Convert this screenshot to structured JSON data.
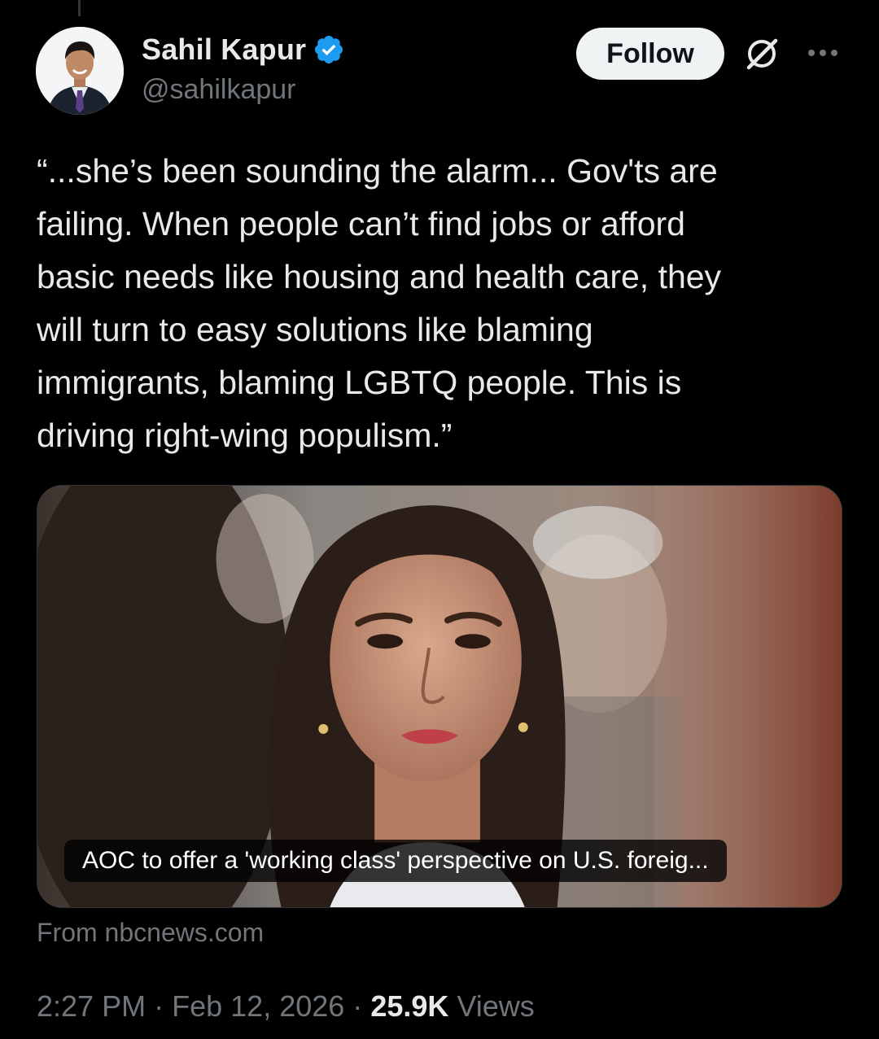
{
  "author": {
    "display_name": "Sahil Kapur",
    "handle": "@sahilkapur",
    "verified": true
  },
  "actions": {
    "follow_label": "Follow",
    "grok_icon": "grok-icon",
    "more_icon": "more-options-icon"
  },
  "tweet": {
    "text": "“...she’s been sounding the alarm... Gov'ts are\nfailing. When people can’t find jobs or afford\nbasic needs like housing and health care, they\nwill turn to easy solutions like blaming\nimmigrants, blaming LGBTQ people. This is\ndriving right-wing populism.”"
  },
  "card": {
    "title": "AOC to offer a 'working class' perspective on U.S. foreig...",
    "source": "From nbcnews.com"
  },
  "meta": {
    "time": "2:27 PM",
    "separator": "·",
    "date": "Feb 12, 2026",
    "views_count": "25.9K",
    "views_label": "Views"
  },
  "colors": {
    "background": "#000000",
    "primary_text": "#e7e9ea",
    "secondary_text": "#71767b",
    "verified_blue": "#1d9bf0",
    "follow_button_bg": "#eff3f4"
  }
}
